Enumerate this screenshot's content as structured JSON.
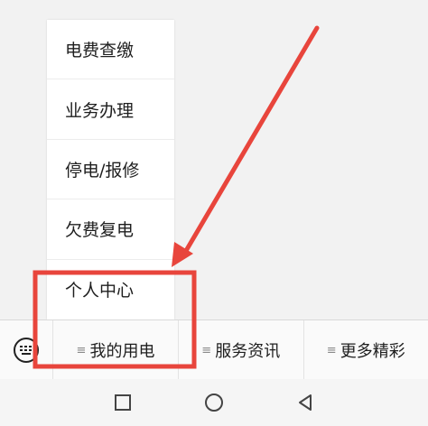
{
  "popup_menu": {
    "items": [
      {
        "label": "电费查缴"
      },
      {
        "label": "业务办理"
      },
      {
        "label": "停电/报修"
      },
      {
        "label": "欠费复电"
      },
      {
        "label": "个人中心"
      }
    ]
  },
  "bottom_bar": {
    "tabs": [
      {
        "icon": "≡",
        "label": "我的用电"
      },
      {
        "icon": "≡",
        "label": "服务资讯"
      },
      {
        "icon": "≡",
        "label": "更多精彩"
      }
    ]
  },
  "annotation": {
    "color": "#e8453c"
  }
}
